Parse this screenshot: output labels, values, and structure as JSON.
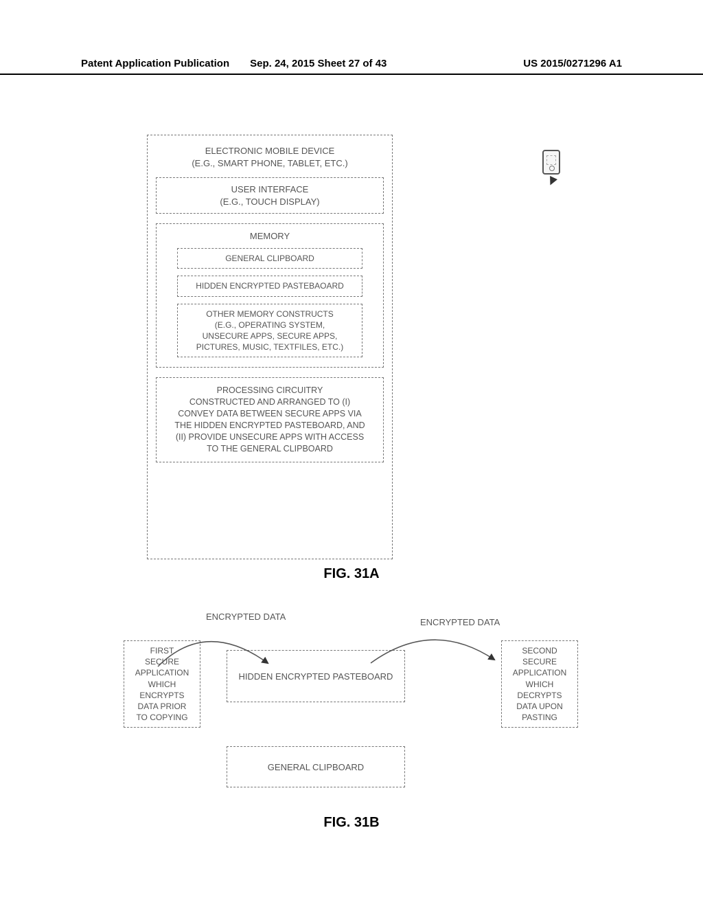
{
  "header": {
    "left": "Patent Application Publication",
    "mid": "Sep. 24, 2015  Sheet 27 of 43",
    "right": "US 2015/0271296 A1"
  },
  "figA": {
    "caption": "FIG. 31A",
    "device_title": "ELECTRONIC MOBILE DEVICE\n(E.G., SMART PHONE, TABLET, ETC.)",
    "user_interface": "USER INTERFACE\n(E.G., TOUCH DISPLAY)",
    "memory_title": "MEMORY",
    "general_clipboard": "GENERAL CLIPBOARD",
    "hidden_pasteboard": "HIDDEN ENCRYPTED PASTEBAOARD",
    "other_memory": "OTHER MEMORY CONSTRUCTS\n(E.G.,  OPERATING SYSTEM,\nUNSECURE APPS, SECURE APPS,\nPICTURES, MUSIC, TEXTFILES, ETC.)",
    "processing": "PROCESSING CIRCUITRY\nCONSTRUCTED AND ARRANGED TO (I)\nCONVEY DATA BETWEEN SECURE APPS VIA\nTHE HIDDEN ENCRYPTED PASTEBOARD, AND\n(II) PROVIDE UNSECURE APPS WITH ACCESS\nTO THE GENERAL CLIPBOARD"
  },
  "figB": {
    "caption": "FIG. 31B",
    "enc_left": "ENCRYPTED DATA",
    "enc_right": "ENCRYPTED DATA",
    "first_app": "FIRST\nSECURE\nAPPLICATION\nWHICH\nENCRYPTS\nDATA PRIOR\nTO COPYING",
    "second_app": "SECOND\nSECURE\nAPPLICATION\nWHICH\nDECRYPTS\nDATA UPON\nPASTING",
    "hidden_pb": "HIDDEN ENCRYPTED PASTEBOARD",
    "general_cb": "GENERAL CLIPBOARD"
  }
}
